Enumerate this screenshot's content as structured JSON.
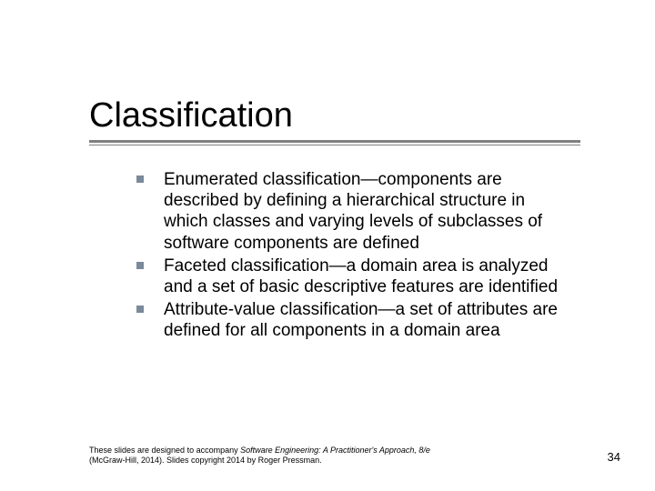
{
  "title": "Classification",
  "bullets": [
    {
      "term": "Enumerated classification",
      "rest": "—components are described by defining a hierarchical structure in which classes and varying levels of subclasses of software components are defined"
    },
    {
      "term": "Faceted classification",
      "rest": "—a domain area is analyzed and a set of basic descriptive features are identified"
    },
    {
      "term": "Attribute-value classification",
      "rest": "—a set of attributes are defined for all components in a domain area"
    }
  ],
  "footer": {
    "line1_pre": "These slides are designed to accompany ",
    "line1_ital": "Software Engineering: A Practitioner's Approach, 8/e",
    "line2": "(McGraw-Hill, 2014). Slides copyright 2014 by Roger Pressman."
  },
  "page_number": "34"
}
